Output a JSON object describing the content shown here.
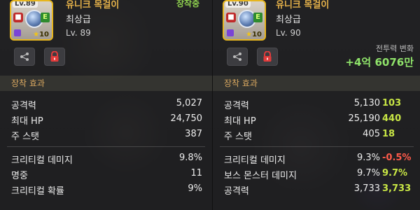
{
  "left_panel": {
    "item_name": "유니크 목걸이",
    "grade": "최상급",
    "level": "Lv. 89",
    "icon_level": "Lv.89",
    "star_force": "10",
    "status": "장착중",
    "section_title": "장착 효과",
    "stats_main": [
      {
        "label": "공격력",
        "value": "5,027"
      },
      {
        "label": "최대 HP",
        "value": "24,750"
      },
      {
        "label": "주 스탯",
        "value": "387"
      }
    ],
    "stats_extra": [
      {
        "label": "크리티컬 데미지",
        "value": "9.8%"
      },
      {
        "label": "명중",
        "value": "11"
      },
      {
        "label": "크리티컬 확률",
        "value": "9%"
      }
    ]
  },
  "right_panel": {
    "item_name": "유니크 목걸이",
    "grade": "최상급",
    "level": "Lv. 90",
    "icon_level": "Lv.90",
    "star_force": "10",
    "power_label": "전투력 변화",
    "power_change": "+4억 6076만",
    "section_title": "장착 효과",
    "stats_main": [
      {
        "label": "공격력",
        "value": "5,130",
        "diff": "103",
        "dir": "up"
      },
      {
        "label": "최대 HP",
        "value": "25,190",
        "diff": "440",
        "dir": "up"
      },
      {
        "label": "주 스탯",
        "value": "405",
        "diff": "18",
        "dir": "up"
      }
    ],
    "stats_extra": [
      {
        "label": "크리티컬 데미지",
        "value": "9.3%",
        "diff": "-0.5%",
        "dir": "down"
      },
      {
        "label": "보스 몬스터 데미지",
        "value": "9.7%",
        "diff": "9.7%",
        "dir": "up"
      },
      {
        "label": "공격력",
        "value": "3,733",
        "diff": "3,733",
        "dir": "up"
      }
    ]
  },
  "icons": {
    "share": "share-icon",
    "lock": "lock-icon",
    "purple": "purple-square-icon",
    "star": "star-icon",
    "e_badge": "E"
  },
  "colors": {
    "item_name": "#e6b24a",
    "equipped": "#8fd14f",
    "increase": "#c8e645",
    "decrease": "#ff5a4a",
    "power": "#8fe36a"
  }
}
